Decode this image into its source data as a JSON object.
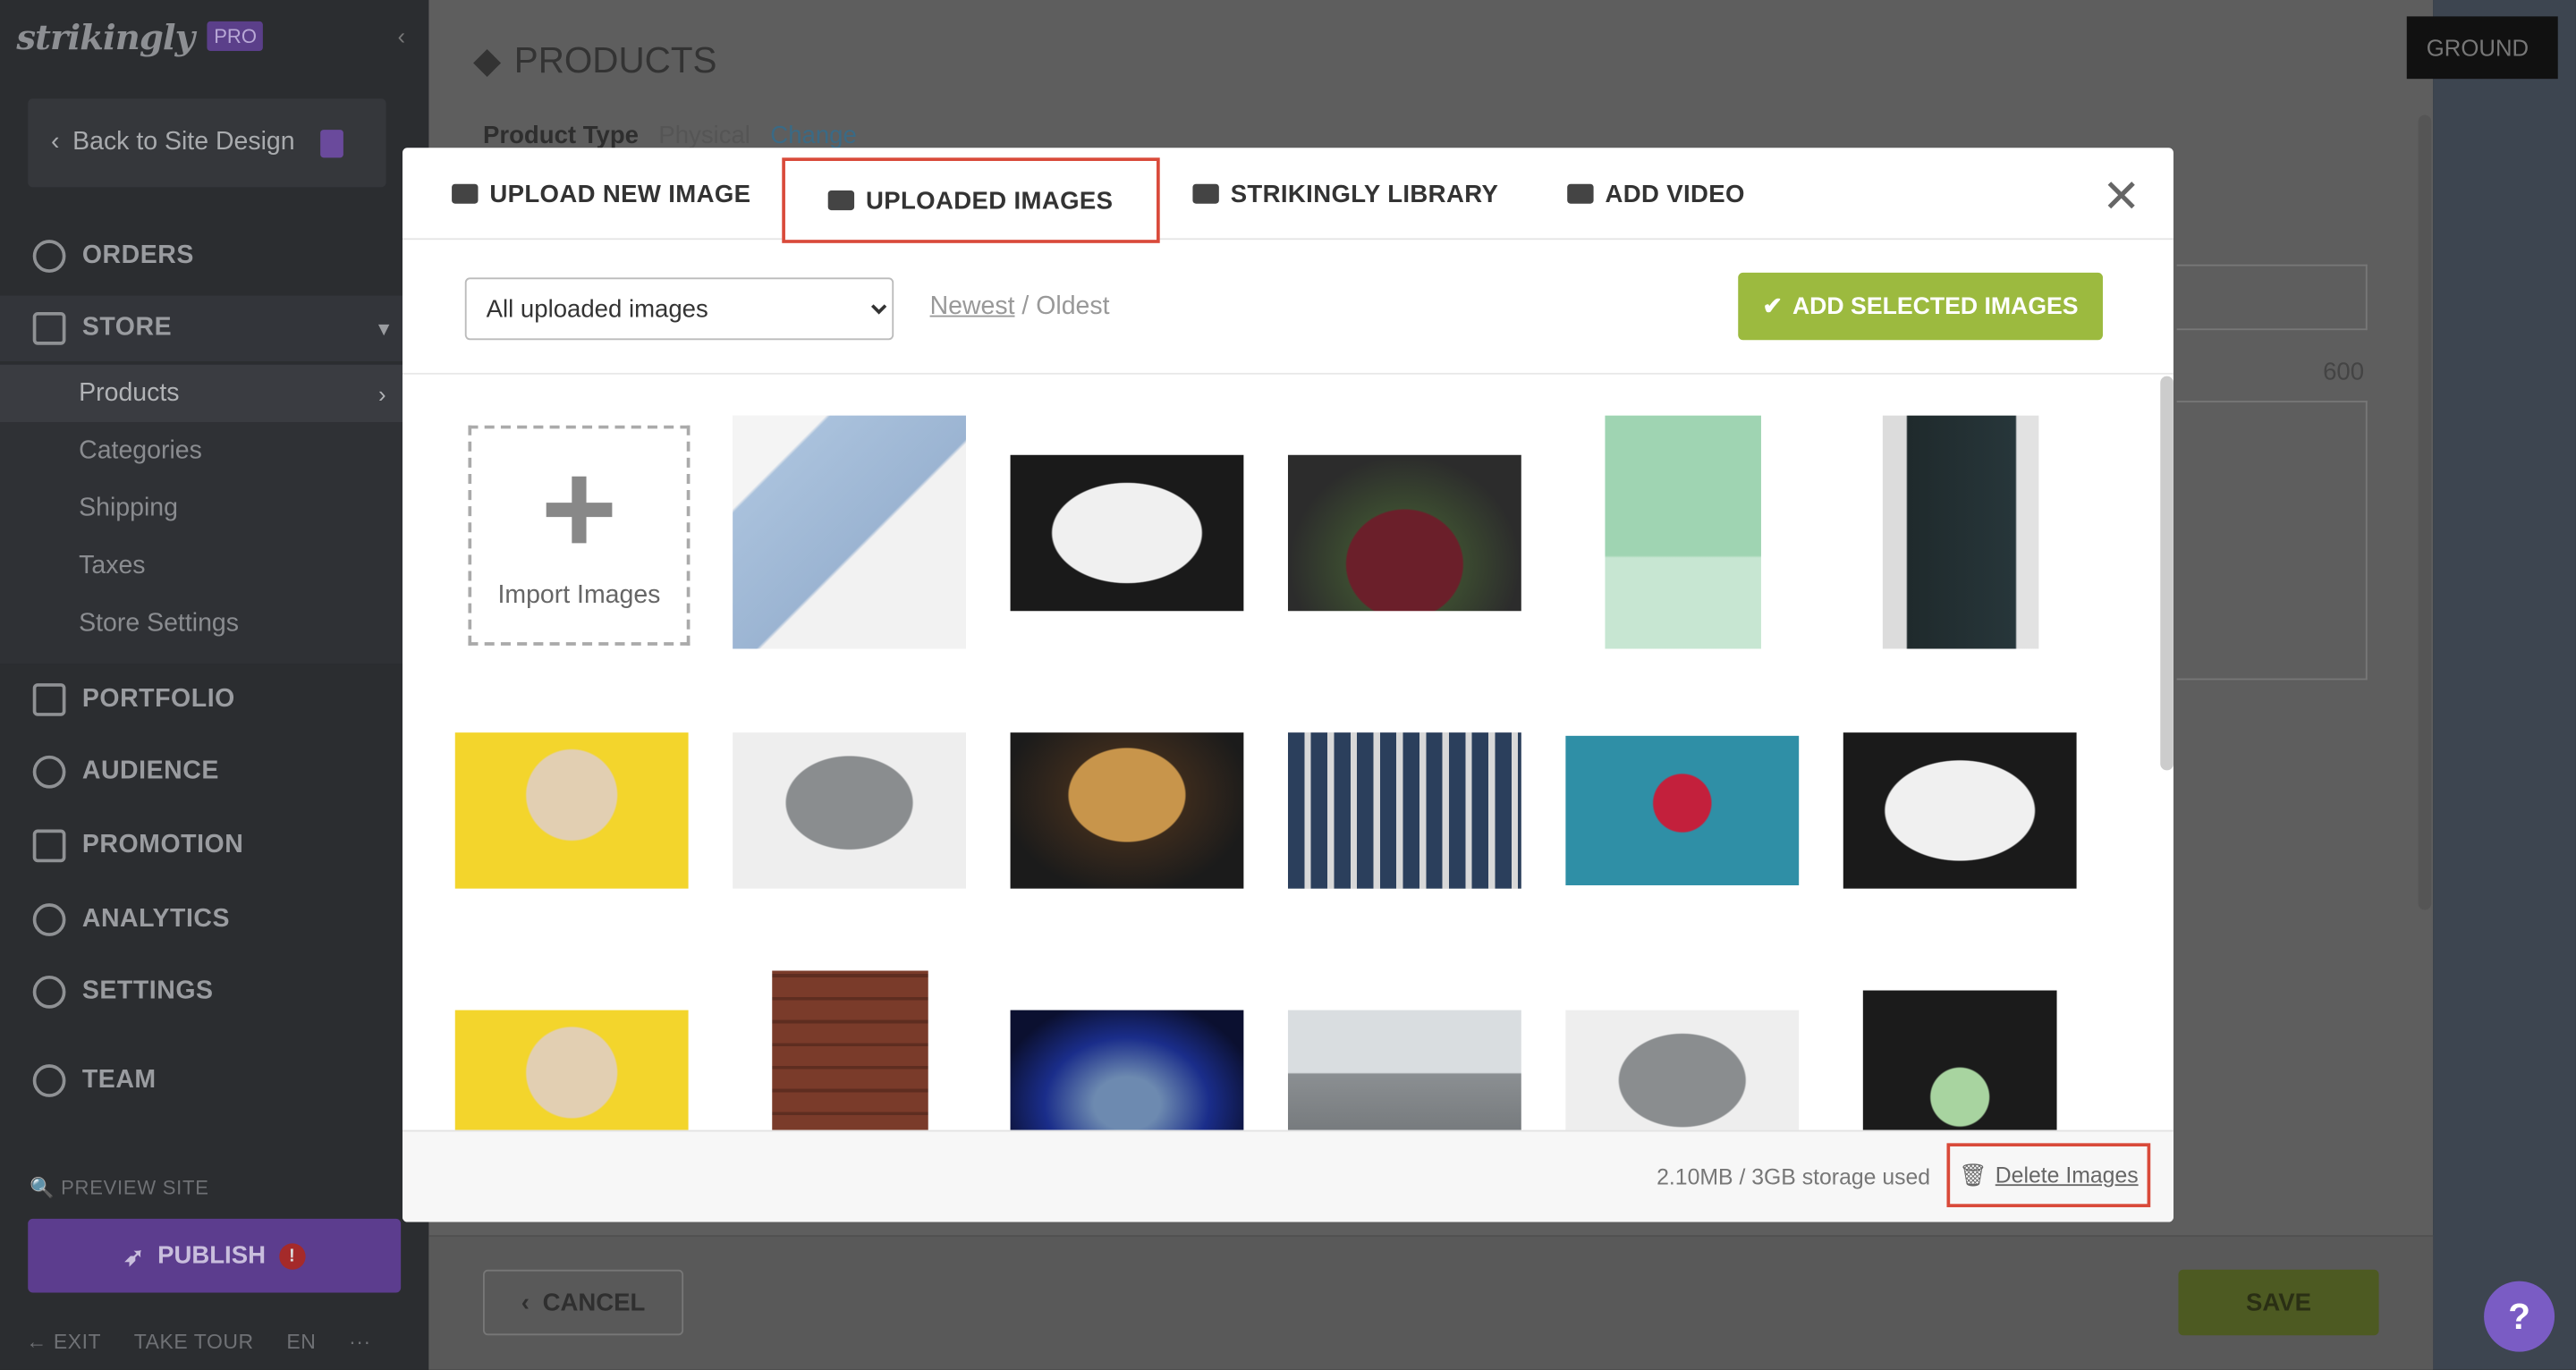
{
  "sidebar": {
    "logo": "strikingly",
    "pro_badge": "PRO",
    "back_label": "Back to Site Design",
    "nav": [
      {
        "label": "ORDERS",
        "icon": "dollar-icon"
      },
      {
        "label": "STORE",
        "icon": "store-icon"
      },
      {
        "label": "PORTFOLIO",
        "icon": "briefcase-icon"
      },
      {
        "label": "AUDIENCE",
        "icon": "people-icon"
      },
      {
        "label": "PROMOTION",
        "icon": "megaphone-icon"
      },
      {
        "label": "ANALYTICS",
        "icon": "pie-chart-icon"
      },
      {
        "label": "SETTINGS",
        "icon": "gear-icon"
      },
      {
        "label": "TEAM",
        "icon": "team-icon"
      }
    ],
    "store_sub": [
      "Products",
      "Categories",
      "Shipping",
      "Taxes",
      "Store Settings"
    ],
    "preview": "PREVIEW SITE",
    "publish": "PUBLISH",
    "footer": [
      "EXIT",
      "TAKE TOUR",
      "EN",
      "···"
    ]
  },
  "page": {
    "title": "PRODUCTS",
    "product_type_label": "Product Type",
    "product_type_value": "Physical",
    "product_type_change": "Change",
    "background_btn": "GROUND",
    "counter": "600",
    "cancel": "CANCEL",
    "save": "SAVE",
    "help": "?"
  },
  "modal": {
    "tabs": [
      {
        "label": "UPLOAD NEW IMAGE",
        "icon": "cloud-upload-icon"
      },
      {
        "label": "UPLOADED IMAGES",
        "icon": "folder-icon",
        "active": true
      },
      {
        "label": "STRIKINGLY LIBRARY",
        "icon": "archive-icon"
      },
      {
        "label": "ADD VIDEO",
        "icon": "film-icon"
      }
    ],
    "filter_options": [
      "All uploaded images"
    ],
    "filter_selected": "All uploaded images",
    "sort_newest": "Newest",
    "sort_sep": " / ",
    "sort_oldest": "Oldest",
    "add_selected": "ADD SELECTED IMAGES",
    "import_label": "Import Images",
    "storage": "2.10MB / 3GB storage used",
    "delete": "Delete Images",
    "colors": {
      "accent_green": "#9cba3f",
      "highlight_red": "#d94a3a",
      "publish_purple": "#5c3d8e"
    }
  }
}
